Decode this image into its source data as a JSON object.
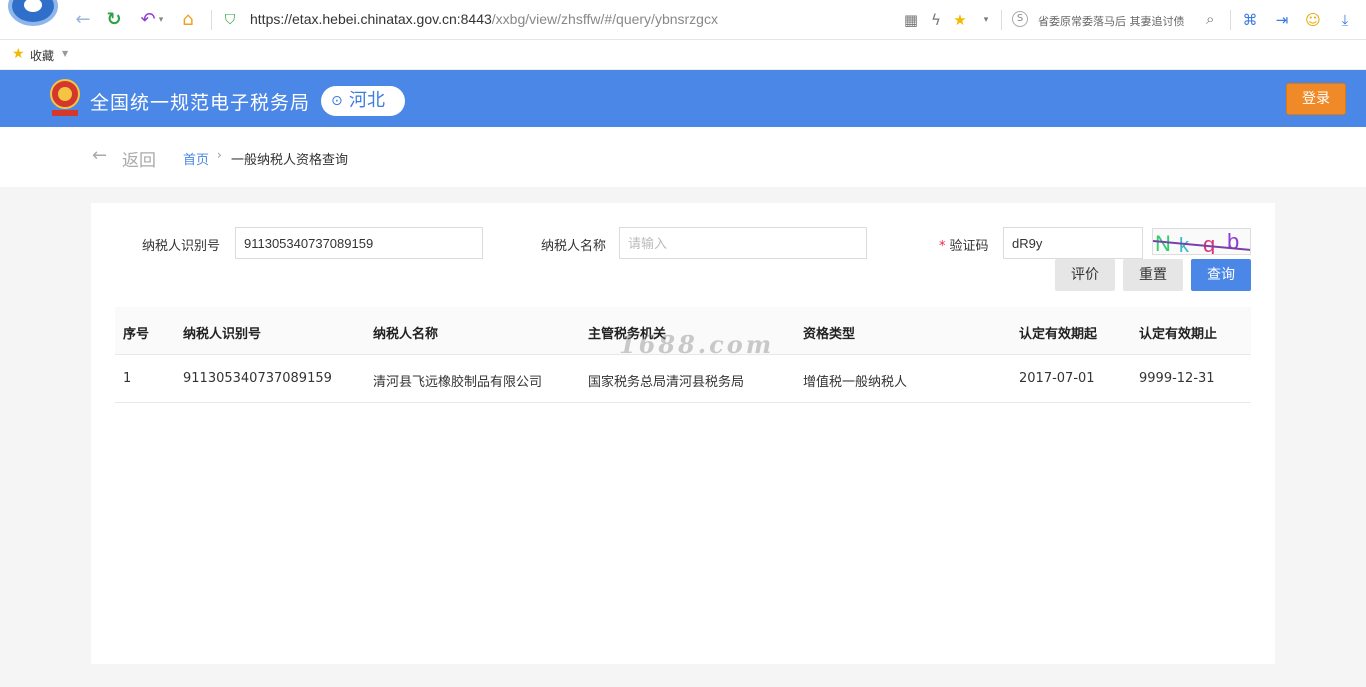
{
  "browser": {
    "url_host": "https://etax.hebei.chinatax.gov.cn:8443",
    "url_path": "/xxbg/view/zhsffw/#/query/ybnsrzgcx",
    "search_text": "省委原常委落马后 其妻追讨债",
    "bookmarks_label": "收藏"
  },
  "header": {
    "site_title": "全国统一规范电子税务局",
    "region": "河北",
    "login_label": "登录"
  },
  "breadcrumb": {
    "back_label": "返回",
    "home": "首页",
    "current": "一般纳税人资格查询"
  },
  "form": {
    "taxpayer_id_label": "纳税人识别号",
    "taxpayer_id_value": "911305340737089159",
    "taxpayer_name_label": "纳税人名称",
    "taxpayer_name_placeholder": "请输入",
    "captcha_required_mark": "*",
    "captcha_label": "验证码",
    "captcha_value": "dR9y",
    "captcha_text": "Nkqb",
    "buttons": {
      "evaluate": "评价",
      "reset": "重置",
      "query": "查询"
    }
  },
  "table": {
    "columns": [
      "序号",
      "纳税人识别号",
      "纳税人名称",
      "主管税务机关",
      "资格类型",
      "认定有效期起",
      "认定有效期止"
    ],
    "rows": [
      [
        "1",
        "911305340737089159",
        "清河县飞远橡胶制品有限公司",
        "国家税务总局清河县税务局",
        "增值税一般纳税人",
        "2017-07-01",
        "9999-12-31"
      ]
    ]
  },
  "watermark": "1688.com",
  "colors": {
    "header_blue": "#4a87e6",
    "login_orange": "#f08a28",
    "primary_button": "#4a87e6"
  }
}
